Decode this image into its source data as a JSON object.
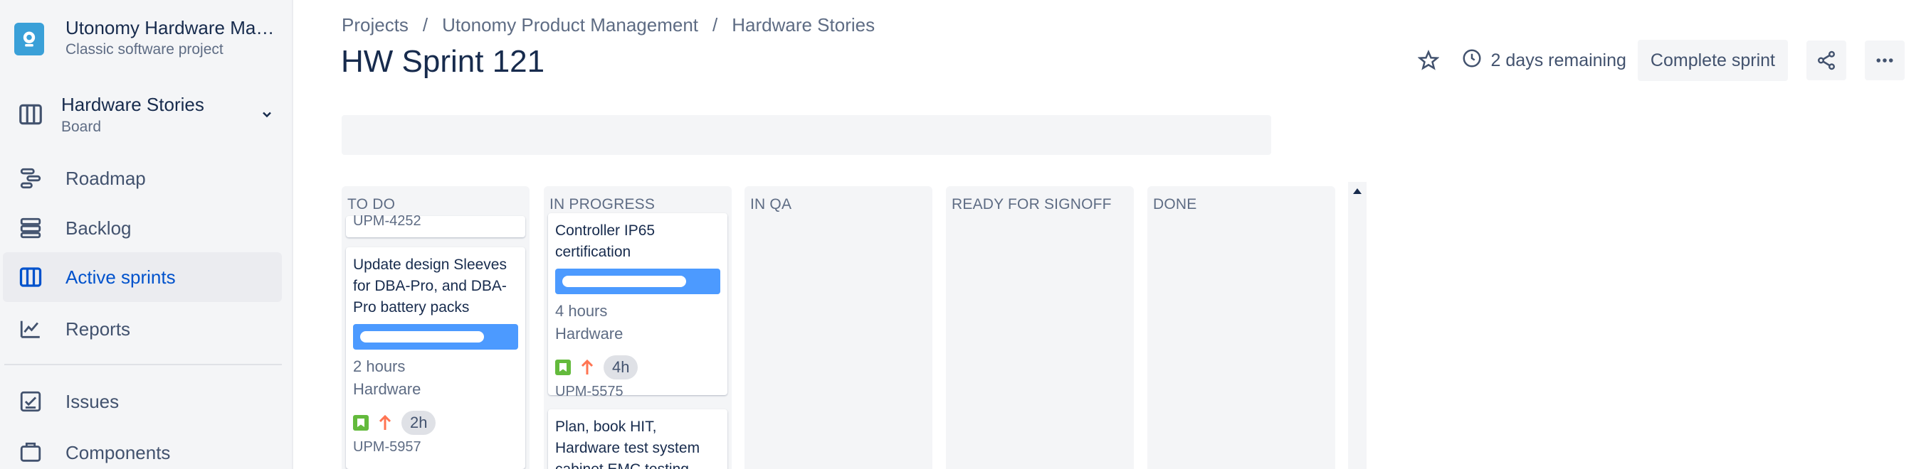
{
  "sidebar": {
    "project": {
      "name": "Utonomy Hardware Management",
      "type": "Classic software project",
      "icon": "project-avatar-icon"
    },
    "board": {
      "name": "Hardware Stories",
      "subtitle": "Board"
    },
    "nav": [
      {
        "label": "Roadmap",
        "icon": "roadmap-icon"
      },
      {
        "label": "Backlog",
        "icon": "backlog-icon"
      },
      {
        "label": "Active sprints",
        "icon": "board-icon",
        "active": true
      },
      {
        "label": "Reports",
        "icon": "reports-icon"
      },
      {
        "label": "Issues",
        "icon": "issues-icon"
      },
      {
        "label": "Components",
        "icon": "components-icon"
      }
    ]
  },
  "breadcrumb": {
    "items": [
      "Projects",
      "Utonomy Product Management",
      "Hardware Stories"
    ],
    "separator": "/"
  },
  "sprint": {
    "title": "HW Sprint 121"
  },
  "header_actions": {
    "remaining": "2 days remaining",
    "complete_label": "Complete sprint",
    "icons": [
      "star-icon",
      "clock-icon",
      "share-icon",
      "more-icon"
    ]
  },
  "board": {
    "columns": [
      {
        "title": "TO DO"
      },
      {
        "title": "IN PROGRESS"
      },
      {
        "title": "IN QA"
      },
      {
        "title": "READY FOR SIGNOFF"
      },
      {
        "title": "DONE"
      }
    ],
    "cards": {
      "todo_top_key": "UPM-4252",
      "todo_main": {
        "summary": "Update design Sleeves for DBA-Pro, and DBA-Pro battery packs",
        "time": "2 hours",
        "component": "Hardware",
        "estimate": "2h",
        "key": "UPM-5957"
      },
      "inprog_main": {
        "summary": "Controller IP65 certification",
        "time": "4 hours",
        "component": "Hardware",
        "estimate": "4h",
        "key": "UPM-5575"
      },
      "inprog_next": {
        "summary": "Plan, book HIT, Hardware test system cabinet EMC testing"
      }
    }
  },
  "colors": {
    "accent": "#0052cc",
    "epic": "#4c9aff",
    "story": "#63ba3c",
    "priority_high": "#ff7452",
    "sidebar_bg": "#f4f5f7",
    "column_bg": "#f4f5f7"
  }
}
